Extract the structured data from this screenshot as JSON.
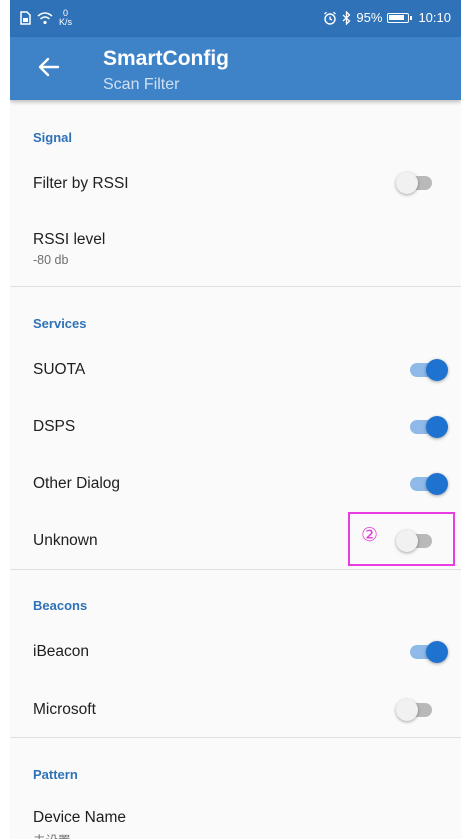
{
  "status_bar": {
    "net_speed_value": "0",
    "net_speed_unit": "K/s",
    "battery": "95%",
    "time": "10:10"
  },
  "app_bar": {
    "title": "SmartConfig",
    "subtitle": "Scan Filter"
  },
  "sections": {
    "signal": {
      "header": "Signal",
      "filter_by_rssi": {
        "label": "Filter by RSSI",
        "enabled": false
      },
      "rssi_level": {
        "label": "RSSI level",
        "value": "-80 db"
      }
    },
    "services": {
      "header": "Services",
      "suota": {
        "label": "SUOTA",
        "enabled": true
      },
      "dsps": {
        "label": "DSPS",
        "enabled": true
      },
      "other_dialog": {
        "label": "Other Dialog",
        "enabled": true
      },
      "unknown": {
        "label": "Unknown",
        "enabled": false,
        "marker": "②"
      }
    },
    "beacons": {
      "header": "Beacons",
      "ibeacon": {
        "label": "iBeacon",
        "enabled": true
      },
      "microsoft": {
        "label": "Microsoft",
        "enabled": false
      }
    },
    "pattern": {
      "header": "Pattern",
      "device_name": {
        "label": "Device Name",
        "value": "未设置"
      }
    }
  },
  "colors": {
    "status_bar": "#2f72b8",
    "app_bar": "#3e82c8",
    "accent": "#1e73d0",
    "highlight": "#e83de0"
  }
}
